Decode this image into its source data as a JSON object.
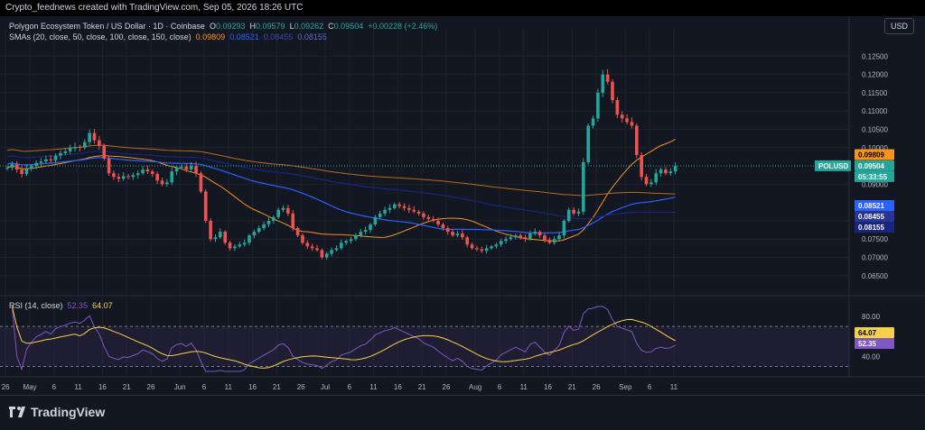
{
  "header": {
    "caption": "Crypto_feednews created with TradingView.com, Sep 05, 2026 18:26 UTC"
  },
  "legend": {
    "title": "Polygon Ecosystem Token / US Dollar · 1D · Coinbase",
    "o_label": "O",
    "o_value": "0.09293",
    "h_label": "H",
    "h_value": "0.09579",
    "l_label": "L",
    "l_value": "0.09262",
    "c_label": "C",
    "c_value": "0.09504",
    "change": "+0.00228 (+2.46%)",
    "sma_label": "SMAs (20, close, 50, close, 100, close, 150, close)",
    "sma_values": [
      "0.09809",
      "0.08521",
      "0.08455",
      "0.08155"
    ]
  },
  "currency": "USD",
  "rsi": {
    "label": "RSI (14, close)",
    "value": "52.35",
    "ma_value": "64.07"
  },
  "footer": {
    "brand": "TradingView"
  },
  "colors": {
    "bg": "#131722",
    "up": "#26a69a",
    "down": "#ef5350",
    "sma20": "#f7931a",
    "sma50": "#2962ff",
    "sma100": "#1a237e",
    "sma150": "#b86a1e",
    "rsi": "#7e57c2",
    "rsi_ma": "#f5d14a"
  },
  "chart_data": {
    "type": "candlestick",
    "symbol": "POLUSD",
    "ylim": [
      0.062,
      0.13
    ],
    "y_ticks": [
      "0.12500",
      "0.12000",
      "0.11500",
      "0.11000",
      "0.10500",
      "0.10000",
      "0.09000",
      "0.08000",
      "0.07500",
      "0.07000",
      "0.06500"
    ],
    "price_badges": [
      {
        "label": "0.09809",
        "value": 0.09809,
        "kind": "sma20"
      },
      {
        "label": "POLUSD",
        "value": 0.09504,
        "kind": "symbol"
      },
      {
        "label": "0.09504",
        "value": 0.09504,
        "kind": "last"
      },
      {
        "label": "05:33:55",
        "kind": "countdown"
      },
      {
        "label": "0.08521",
        "value": 0.08521,
        "kind": "sma50"
      },
      {
        "label": "0.08455",
        "value": 0.08455,
        "kind": "sma100"
      },
      {
        "label": "0.08155",
        "value": 0.08155,
        "kind": "sma150"
      }
    ],
    "x_ticks": [
      "26",
      "May",
      "6",
      "11",
      "16",
      "21",
      "26",
      "Jun",
      "6",
      "11",
      "16",
      "21",
      "26",
      "Jul",
      "6",
      "11",
      "16",
      "21",
      "26",
      "Aug",
      "6",
      "11",
      "16",
      "21",
      "26",
      "Sep",
      "6",
      "11"
    ],
    "x_tick_index": [
      -5,
      0,
      5,
      10,
      15,
      20,
      25,
      31,
      36,
      41,
      46,
      51,
      56,
      61,
      66,
      71,
      76,
      81,
      86,
      92,
      97,
      102,
      107,
      112,
      117,
      123,
      128,
      133
    ],
    "closes": [
      0.0945,
      0.0955,
      0.094,
      0.0928,
      0.0942,
      0.095,
      0.0958,
      0.0962,
      0.0968,
      0.0965,
      0.0978,
      0.0985,
      0.099,
      0.0998,
      0.1002,
      0.1,
      0.1015,
      0.104,
      0.102,
      0.1005,
      0.097,
      0.093,
      0.092,
      0.0915,
      0.0922,
      0.092,
      0.0925,
      0.093,
      0.094,
      0.0935,
      0.0928,
      0.091,
      0.09,
      0.0905,
      0.0935,
      0.0945,
      0.0948,
      0.094,
      0.095,
      0.093,
      0.088,
      0.08,
      0.075,
      0.0755,
      0.077,
      0.074,
      0.0725,
      0.073,
      0.0735,
      0.074,
      0.076,
      0.077,
      0.078,
      0.079,
      0.08,
      0.081,
      0.083,
      0.0835,
      0.082,
      0.078,
      0.076,
      0.074,
      0.073,
      0.0725,
      0.072,
      0.07,
      0.071,
      0.072,
      0.0725,
      0.074,
      0.0745,
      0.075,
      0.076,
      0.077,
      0.0775,
      0.079,
      0.081,
      0.082,
      0.083,
      0.0835,
      0.0845,
      0.084,
      0.0835,
      0.083,
      0.0825,
      0.082,
      0.081,
      0.0805,
      0.08,
      0.079,
      0.078,
      0.077,
      0.076,
      0.0765,
      0.0755,
      0.0735,
      0.0725,
      0.0722,
      0.0718,
      0.0725,
      0.073,
      0.0735,
      0.0745,
      0.075,
      0.0755,
      0.076,
      0.0755,
      0.075,
      0.0765,
      0.077,
      0.076,
      0.0748,
      0.074,
      0.075,
      0.076,
      0.08,
      0.083,
      0.082,
      0.0825,
      0.096,
      0.106,
      0.108,
      0.115,
      0.12,
      0.118,
      0.113,
      0.109,
      0.108,
      0.107,
      0.106,
      0.098,
      0.092,
      0.09,
      0.0905,
      0.093,
      0.094,
      0.093,
      0.0935,
      0.095
    ],
    "rsi_ylim": [
      25,
      90
    ],
    "rsi_ticks": [
      "80.00",
      "40.00"
    ],
    "rsi_band": [
      70,
      30
    ]
  }
}
